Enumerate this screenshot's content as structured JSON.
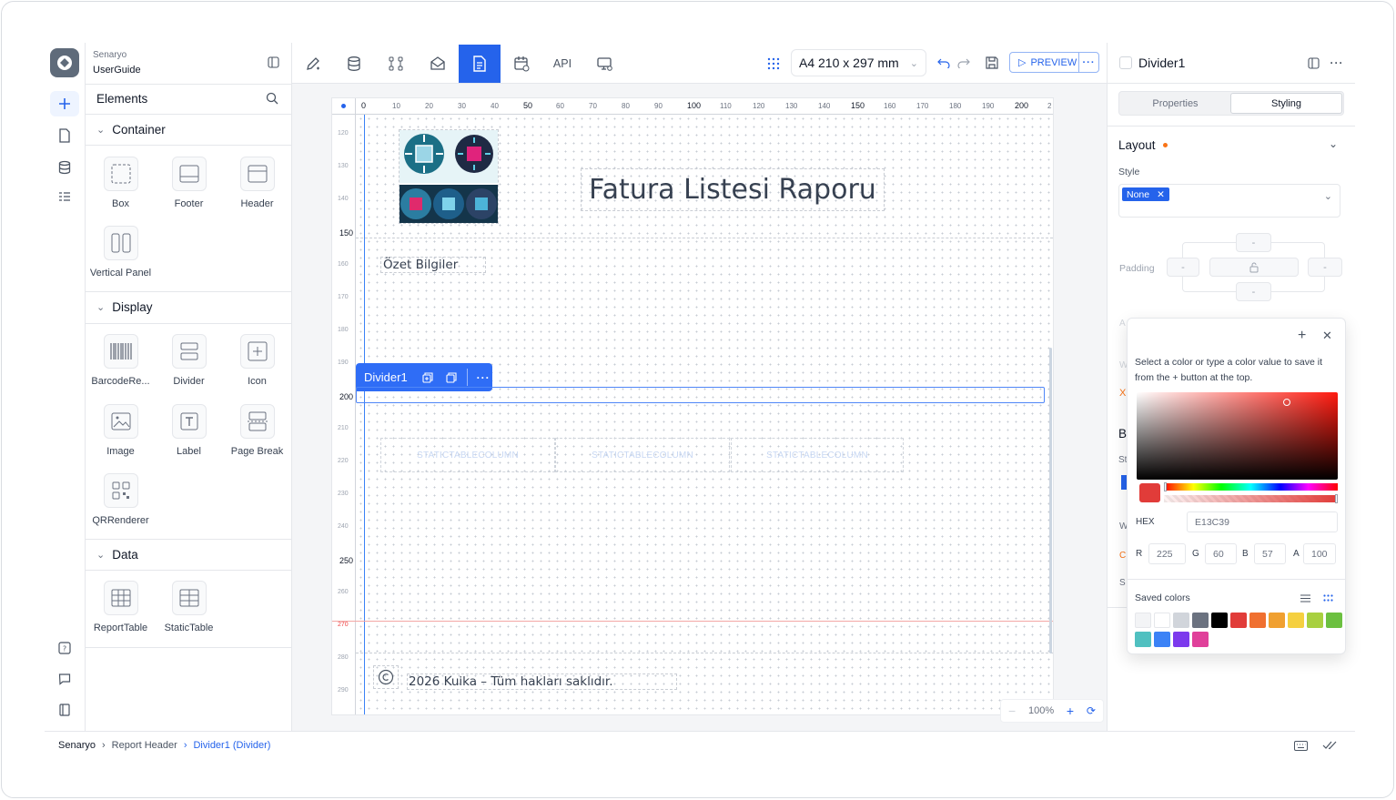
{
  "app": {
    "org": "Senaryo",
    "name": "UserGuide"
  },
  "elements_panel": {
    "title": "Elements",
    "sections": [
      {
        "title": "Container",
        "items": [
          "Box",
          "Footer",
          "Header",
          "Vertical Panel"
        ]
      },
      {
        "title": "Display",
        "items": [
          "BarcodeRe...",
          "Divider",
          "Icon",
          "Image",
          "Label",
          "Page Break",
          "QRRenderer"
        ]
      },
      {
        "title": "Data",
        "items": [
          "ReportTable",
          "StaticTable"
        ]
      }
    ]
  },
  "toolbar": {
    "api_label": "API",
    "page_size": "A4 210 x 297 mm",
    "preview_label": "PREVIEW"
  },
  "rulers": {
    "top": [
      "0",
      "10",
      "20",
      "30",
      "40",
      "50",
      "60",
      "70",
      "80",
      "90",
      "100",
      "110",
      "120",
      "130",
      "140",
      "150",
      "160",
      "170",
      "180",
      "190",
      "200",
      "2"
    ],
    "left": [
      "120",
      "130",
      "140",
      "150",
      "160",
      "170",
      "180",
      "190",
      "200",
      "210",
      "220",
      "230",
      "240",
      "250",
      "260",
      "270",
      "280",
      "290"
    ]
  },
  "report": {
    "title": "Fatura Listesi Raporu",
    "section_label": "Özet Bilgiler",
    "static_columns": [
      "STATICTABLECOLUMN",
      "STATICTABLECOLUMN",
      "STATICTABLECOLUMN"
    ],
    "footer_text": "2026 Kuika – Tüm hakları saklıdır.",
    "selected_element": "Divider1"
  },
  "zoom": {
    "level": "100%"
  },
  "right_panel": {
    "title": "Divider1",
    "tabs": [
      "Properties",
      "Styling"
    ],
    "active_tab": "Styling",
    "layout_title": "Layout",
    "style_label": "Style",
    "style_chip": "None",
    "padding_label": "Padding",
    "padding_value": "-"
  },
  "color_picker": {
    "hint": "Select a color or type a color value to save it from the + button at the top.",
    "hex_label": "HEX",
    "hex_value": "E13C39",
    "r_label": "R",
    "r": "225",
    "g_label": "G",
    "g": "60",
    "b_label": "B",
    "b": "57",
    "a_label": "A",
    "a": "100",
    "saved_label": "Saved colors",
    "current_color": "#e13c39",
    "saved_colors": [
      "#f3f4f6",
      "#ffffff",
      "#d1d5db",
      "#6b7280",
      "#000000",
      "#e13c39",
      "#f07030",
      "#f0a030",
      "#f5d040",
      "#a8d040",
      "#6cc040",
      "#50c0c0",
      "#3b82f6",
      "#7c3aed",
      "#e0409a"
    ]
  },
  "breadcrumb": [
    "Senaryo",
    "Report Header",
    "Divider1 (Divider)"
  ]
}
